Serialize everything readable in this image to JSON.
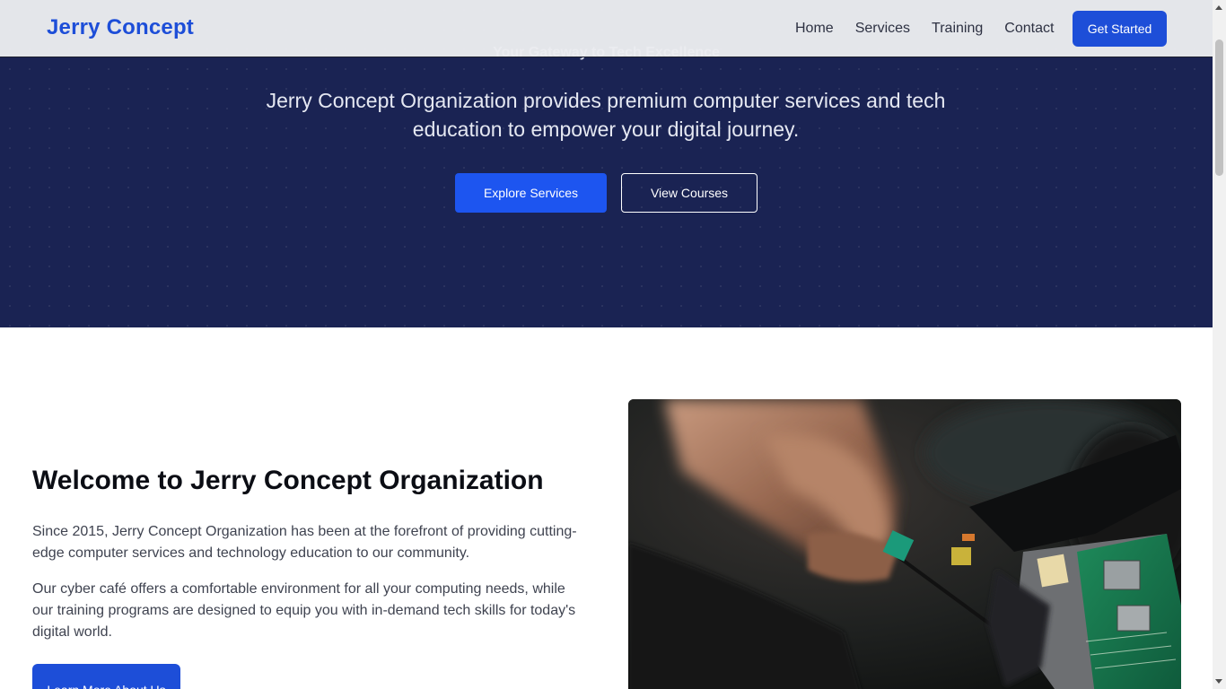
{
  "header": {
    "brand": "Jerry Concept",
    "nav": [
      "Home",
      "Services",
      "Training",
      "Contact"
    ],
    "cta_label": "Get Started"
  },
  "hero": {
    "tagline": "Your Gateway to Tech Excellence",
    "description": "Jerry Concept Organization provides premium computer services and tech education to empower your digital journey.",
    "primary_button": "Explore Services",
    "secondary_button": "View Courses"
  },
  "about": {
    "title": "Welcome to Jerry Concept Organization",
    "paragraph1": "Since 2015, Jerry Concept Organization has been at the forefront of providing cutting-edge computer services and technology education to our community.",
    "paragraph2": "Our cyber café offers a comfortable environment for all your computing needs, while our training programs are designed to equip you with in-demand tech skills for today's digital world.",
    "button": "Learn More About Us"
  },
  "colors": {
    "brand": "#1d4ed8",
    "hero_background": "#1a2353",
    "primary_button": "#1d55f0"
  }
}
